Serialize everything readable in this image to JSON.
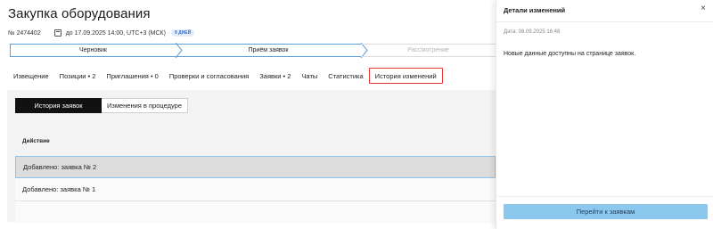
{
  "page": {
    "title": "Закупка оборудования",
    "number": "№ 2474402",
    "deadline": "до 17.09.2025 14:00, UTC+3 (МСК)",
    "days_badge": "9 дней"
  },
  "stages": [
    {
      "label": "Черновик",
      "state": "done"
    },
    {
      "label": "Приём заявок",
      "state": "current"
    },
    {
      "label": "Рассмотрение",
      "state": "upcoming"
    }
  ],
  "tabs": [
    {
      "label": "Извещение"
    },
    {
      "label": "Позиции • 2"
    },
    {
      "label": "Приглашения • 0"
    },
    {
      "label": "Проверки и согласования"
    },
    {
      "label": "Заявки • 2"
    },
    {
      "label": "Чаты"
    },
    {
      "label": "Статистика"
    },
    {
      "label": "История изменений",
      "active": true
    }
  ],
  "segment": {
    "selected": "История заявок",
    "other": "Изменения в процедуре"
  },
  "table": {
    "header": "Действие",
    "rows": [
      "Добавлено: заявка № 2",
      "Добавлено: заявка № 1"
    ]
  },
  "drawer": {
    "title": "Детали изменений",
    "close": "×",
    "date": "Дата: 08.09.2025 16:48",
    "message": "Новые данные доступны на странице заявок.",
    "button": "Перейти к заявкам"
  },
  "colors": {
    "accent_blue": "#5aa0dd",
    "active_tab_border": "#e53935",
    "button_bg": "#8cc8ee"
  }
}
